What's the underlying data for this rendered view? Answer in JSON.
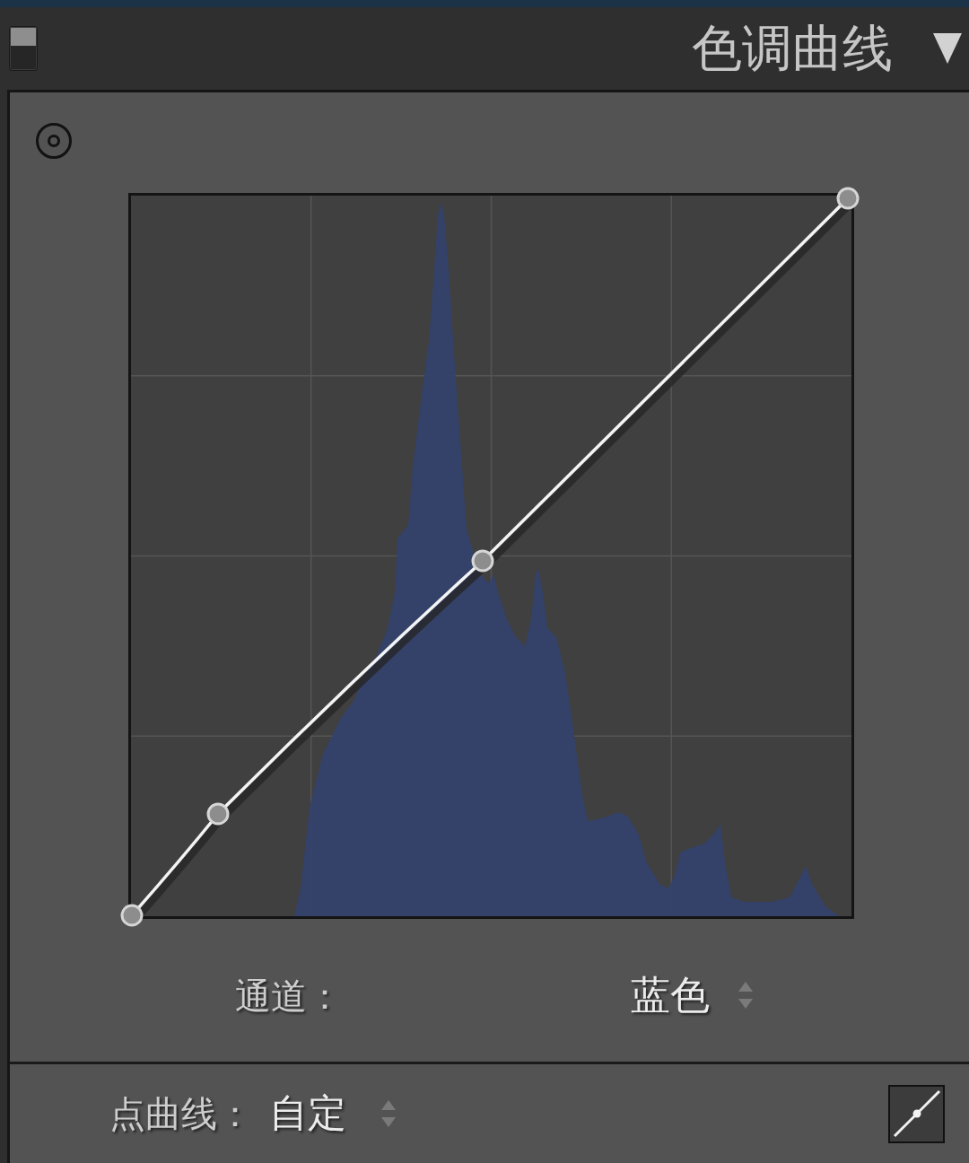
{
  "panel": {
    "title": "色调曲线",
    "enabled": true,
    "expanded": true
  },
  "channel": {
    "label": "通道：",
    "value": "蓝色"
  },
  "point_curve": {
    "label": "点曲线：",
    "value": "自定"
  }
}
